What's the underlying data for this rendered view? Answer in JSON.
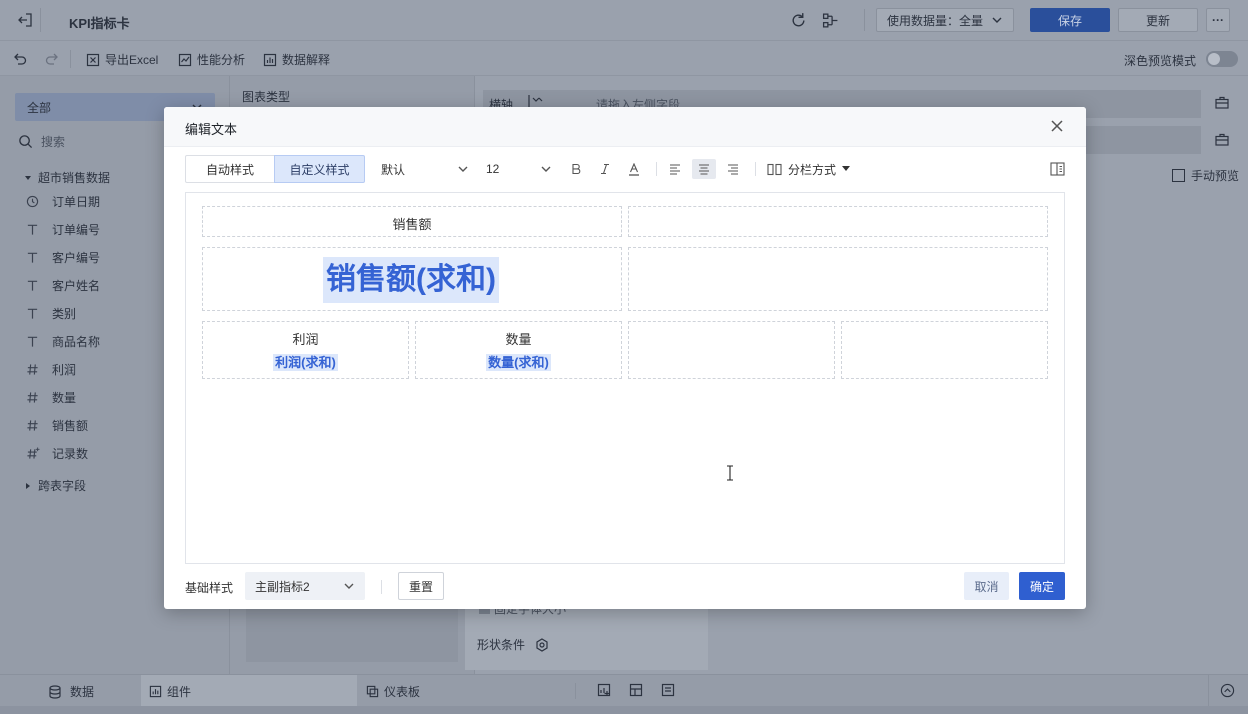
{
  "app": {
    "title": "KPI指标卡",
    "data_volume_label": "使用数据量：全量",
    "save_label": "保存",
    "update_label": "更新",
    "more_label": "···"
  },
  "toolbar": {
    "export_excel": "导出Excel",
    "performance": "性能分析",
    "data_explain": "数据解释",
    "dark_preview": "深色预览模式"
  },
  "left_panel": {
    "filter_value": "全部",
    "search_placeholder": "搜索",
    "group_name": "超市销售数据",
    "fields": [
      {
        "icon": "clock-icon",
        "label": "订单日期"
      },
      {
        "icon": "text-icon",
        "label": "订单编号"
      },
      {
        "icon": "text-icon",
        "label": "客户编号"
      },
      {
        "icon": "text-icon",
        "label": "客户姓名"
      },
      {
        "icon": "text-icon",
        "label": "类别"
      },
      {
        "icon": "text-icon",
        "label": "商品名称"
      },
      {
        "icon": "number-icon",
        "label": "利润"
      },
      {
        "icon": "number-icon",
        "label": "数量"
      },
      {
        "icon": "number-icon",
        "label": "销售额"
      },
      {
        "icon": "number-star-icon",
        "label": "记录数"
      }
    ],
    "cross_table": "跨表字段"
  },
  "mid_panel": {
    "chart_type": "图表类型",
    "fix_font": "固定字体大小",
    "shape_condition": "形状条件"
  },
  "right_panel": {
    "x_axis": "横轴",
    "x_axis_placeholder": "请拖入左侧字段",
    "manual_preview": "手动预览"
  },
  "bottom_bar": {
    "data_tab": "数据",
    "component_tab": "组件",
    "dashboard_tab": "仪表板"
  },
  "modal": {
    "title": "编辑文本",
    "tab_auto": "自动样式",
    "tab_custom": "自定义样式",
    "font_family": "默认",
    "font_size": "12",
    "column_mode": "分栏方式",
    "cells": {
      "top_title": "销售额",
      "main_value": "销售额(求和)",
      "profit_label": "利润",
      "profit_value": "利润(求和)",
      "qty_label": "数量",
      "qty_value": "数量(求和)"
    },
    "footer": {
      "base_style_label": "基础样式",
      "base_style_value": "主副指标2",
      "reset": "重置",
      "cancel": "取消",
      "confirm": "确定"
    }
  },
  "colors": {
    "primary": "#2f5fd0",
    "highlight_bg": "#dce7fb",
    "highlight_text": "#3563d4"
  }
}
